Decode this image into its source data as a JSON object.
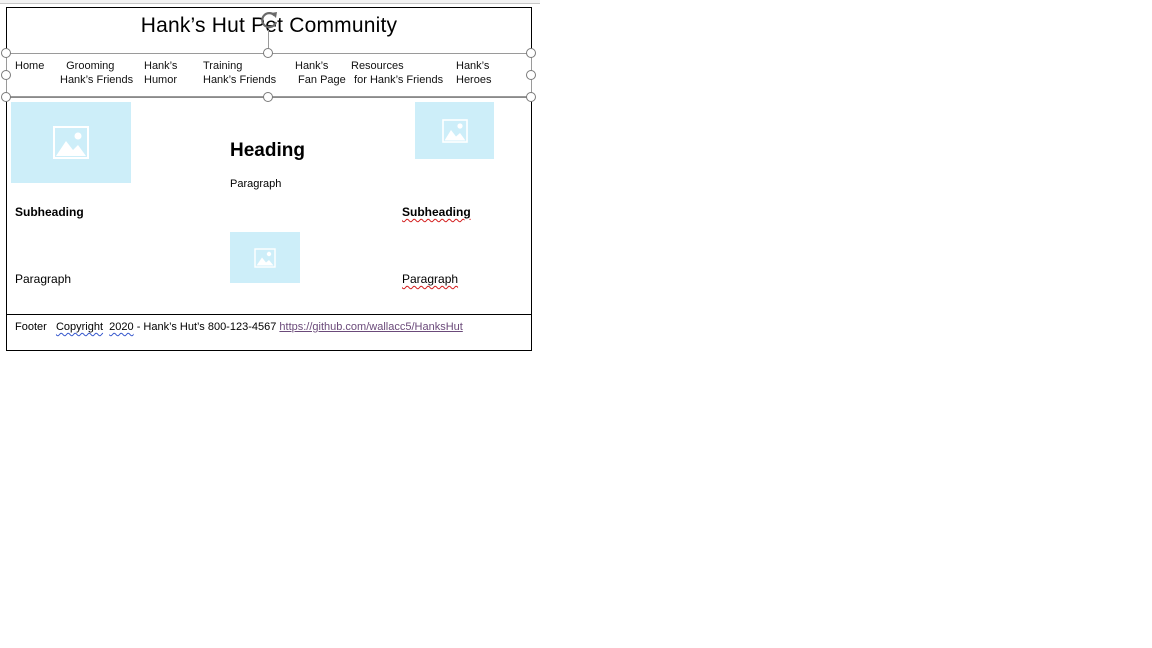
{
  "header": {
    "title": "Hank’s Hut Pet Community"
  },
  "nav": {
    "items": [
      {
        "label": "Home"
      },
      {
        "label": "  Grooming\nHank’s Friends"
      },
      {
        "label": "Hank’s\nHumor"
      },
      {
        "label": "Training\nHank’s Friends"
      },
      {
        "label": "Hank’s\n Fan Page"
      },
      {
        "label": "Resources\n for Hank’s Friends"
      },
      {
        "label": "Hank’s\nHeroes"
      }
    ]
  },
  "center": {
    "heading": "Heading",
    "paragraph": "Paragraph"
  },
  "left_column": {
    "subheading": "Subheading",
    "paragraph": "Paragraph"
  },
  "right_column": {
    "subheading": "Subheading",
    "paragraph": "Paragraph"
  },
  "footer": {
    "label": "Footer",
    "copyright_word": "Copyright",
    "year": "2020",
    "contact": " - Hank’s Hut’s 800-123-4567 ",
    "link": "https://github.com/wallacc5/HanksHut"
  },
  "icons": {
    "placeholder": "image-placeholder-icon",
    "rotate": "rotate-handle-icon"
  },
  "colors": {
    "placeholder_bg": "#cdeef9",
    "link": "#6b4a7a",
    "spellcheck": "#d21a1a"
  }
}
